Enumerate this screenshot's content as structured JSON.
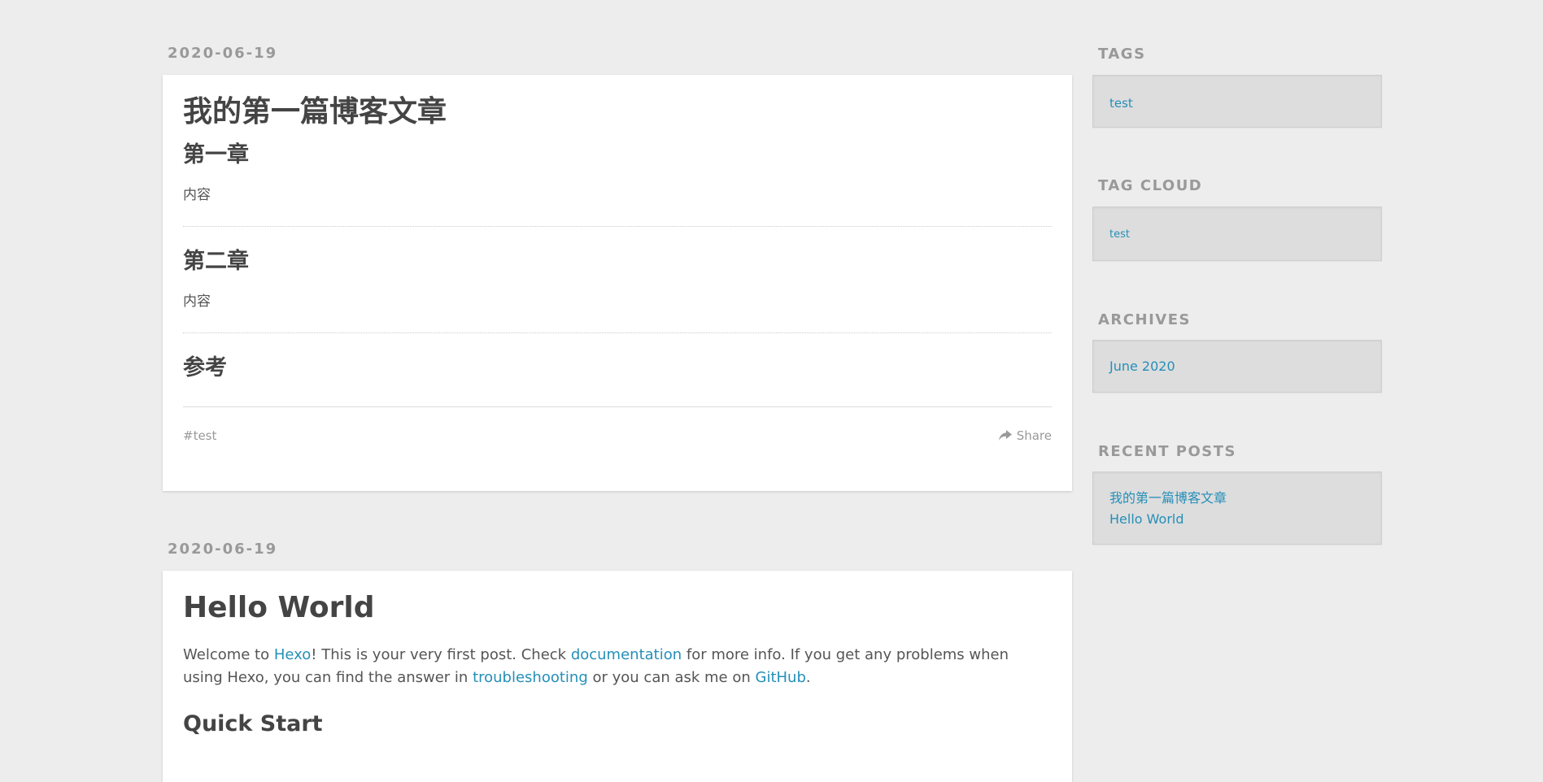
{
  "posts": [
    {
      "date": "2020-06-19",
      "title": "我的第一篇博客文章",
      "sections": [
        {
          "heading": "第一章",
          "body": "内容"
        },
        {
          "heading": "第二章",
          "body": "内容"
        },
        {
          "heading": "参考"
        }
      ],
      "tag": "#test",
      "share_label": "Share",
      "share_icon": "share-arrow-icon"
    },
    {
      "date": "2020-06-19",
      "title": "Hello World",
      "intro": {
        "part1": "Welcome to ",
        "link1": "Hexo",
        "part2": "! This is your very first post. Check ",
        "link2": "documentation",
        "part3": " for more info. If you get any problems when using Hexo, you can find the answer in ",
        "link3": "troubleshooting",
        "part4": " or you can ask me on ",
        "link4": "GitHub",
        "part5": "."
      },
      "next_heading": "Quick Start"
    }
  ],
  "sidebar": {
    "tags": {
      "title": "TAGS",
      "items": [
        "test"
      ]
    },
    "tag_cloud": {
      "title": "TAG CLOUD",
      "items": [
        "test"
      ]
    },
    "archives": {
      "title": "ARCHIVES",
      "items": [
        "June 2020"
      ]
    },
    "recent_posts": {
      "title": "RECENT POSTS",
      "items": [
        "我的第一篇博客文章",
        "Hello World"
      ]
    }
  },
  "colors": {
    "background": "#ededed",
    "card": "#ffffff",
    "link": "#258fb8",
    "muted": "#999999",
    "heading": "#444444",
    "widget_bg": "#dddddd"
  }
}
